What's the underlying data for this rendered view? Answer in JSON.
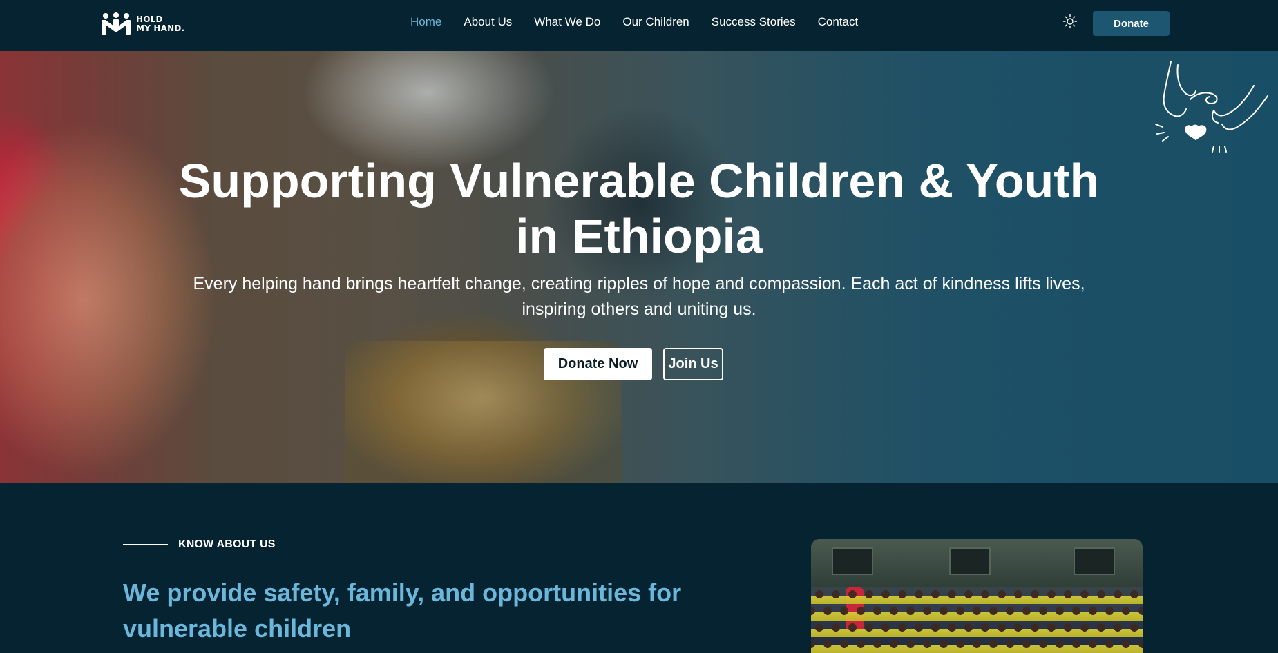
{
  "navbar": {
    "logo": {
      "line1": "HOLD",
      "line2": "MY HAND."
    },
    "links": [
      {
        "label": "Home",
        "active": true
      },
      {
        "label": "About Us"
      },
      {
        "label": "What We Do"
      },
      {
        "label": "Our Children"
      },
      {
        "label": "Success Stories"
      },
      {
        "label": "Contact"
      }
    ],
    "theme_icon": "sun-icon",
    "donate_label": "Donate"
  },
  "hero": {
    "title": "Supporting Vulnerable Children & Youth in Ethiopia",
    "subtitle": "Every helping hand brings heartfelt change, creating ripples of hope and compassion. Each act of kindness lifts lives, inspiring others and uniting us.",
    "primary_button": "Donate Now",
    "secondary_button": "Join Us",
    "illustration_icon": "holding-hands-heart-icon"
  },
  "about": {
    "eyebrow": "KNOW ABOUT US",
    "heading": "We provide safety, family, and opportunities for vulnerable children"
  },
  "colors": {
    "background": "#062331",
    "accent": "#6ab7db",
    "button_bg": "#1d5670"
  }
}
